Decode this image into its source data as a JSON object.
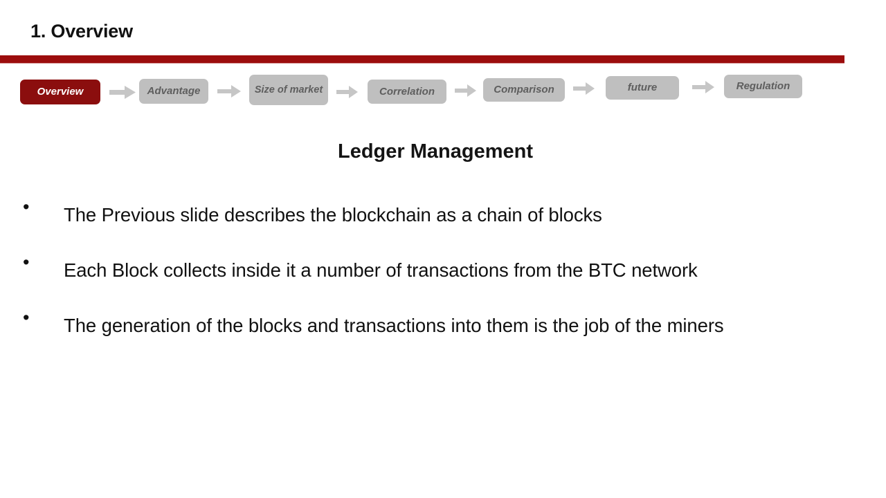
{
  "slide": {
    "title": "1. Overview",
    "accent_color": "#9c0d0d",
    "chip_active_color": "#8b0e0e",
    "chip_inactive_color": "#bfbfbf",
    "arrow_color": "#c6c6c6"
  },
  "breadcrumb": {
    "chips": [
      {
        "label": "Overview",
        "active": true
      },
      {
        "label": "Advantage",
        "active": false
      },
      {
        "label": "Size of market",
        "active": false
      },
      {
        "label": "Correlation",
        "active": false
      },
      {
        "label": "Comparison",
        "active": false
      },
      {
        "label": "future",
        "active": false
      },
      {
        "label": "Regulation",
        "active": false
      }
    ],
    "separator_icon": "right-arrow-icon"
  },
  "main": {
    "heading": "Ledger Management",
    "bullet_marker": "•",
    "bullets": [
      "The Previous slide describes the blockchain as a chain of blocks",
      "Each Block collects inside it a number of transactions from the BTC network",
      "The generation of the blocks and transactions into them is the job of the miners"
    ]
  }
}
